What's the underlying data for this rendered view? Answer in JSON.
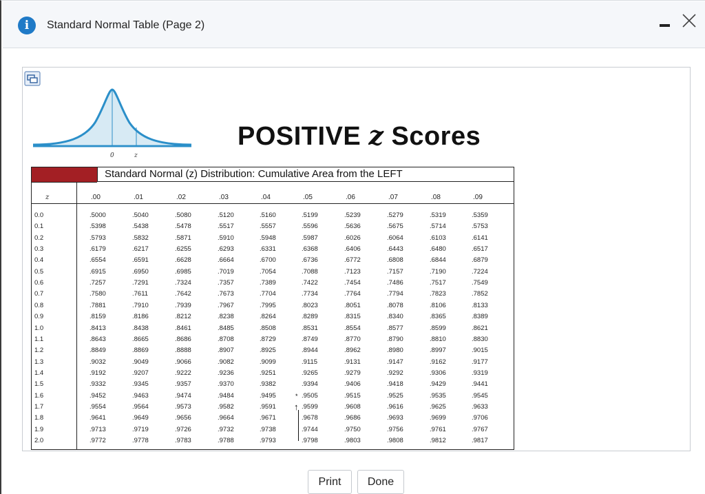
{
  "dialog": {
    "title": "Standard Normal Table (Page 2)",
    "accent": "#1f7ac7"
  },
  "figure": {
    "curve_label_zero": "0",
    "curve_label_z": "z",
    "heading_pre": "POSITIVE ",
    "heading_z": "z",
    "heading_post": " Scores"
  },
  "table": {
    "caption": "Standard Normal (z) Distribution: Cumulative Area from the LEFT",
    "header_color": "#a31f24",
    "z_header": "z",
    "columns": [
      ".00",
      ".01",
      ".02",
      ".03",
      ".04",
      ".05",
      ".06",
      ".07",
      ".08",
      ".09"
    ],
    "rows": [
      {
        "z": "0.0",
        "v": [
          ".5000",
          ".5040",
          ".5080",
          ".5120",
          ".5160",
          ".5199",
          ".5239",
          ".5279",
          ".5319",
          ".5359"
        ]
      },
      {
        "z": "0.1",
        "v": [
          ".5398",
          ".5438",
          ".5478",
          ".5517",
          ".5557",
          ".5596",
          ".5636",
          ".5675",
          ".5714",
          ".5753"
        ]
      },
      {
        "z": "0.2",
        "v": [
          ".5793",
          ".5832",
          ".5871",
          ".5910",
          ".5948",
          ".5987",
          ".6026",
          ".6064",
          ".6103",
          ".6141"
        ]
      },
      {
        "z": "0.3",
        "v": [
          ".6179",
          ".6217",
          ".6255",
          ".6293",
          ".6331",
          ".6368",
          ".6406",
          ".6443",
          ".6480",
          ".6517"
        ]
      },
      {
        "z": "0.4",
        "v": [
          ".6554",
          ".6591",
          ".6628",
          ".6664",
          ".6700",
          ".6736",
          ".6772",
          ".6808",
          ".6844",
          ".6879"
        ]
      },
      {
        "z": "0.5",
        "v": [
          ".6915",
          ".6950",
          ".6985",
          ".7019",
          ".7054",
          ".7088",
          ".7123",
          ".7157",
          ".7190",
          ".7224"
        ]
      },
      {
        "z": "0.6",
        "v": [
          ".7257",
          ".7291",
          ".7324",
          ".7357",
          ".7389",
          ".7422",
          ".7454",
          ".7486",
          ".7517",
          ".7549"
        ]
      },
      {
        "z": "0.7",
        "v": [
          ".7580",
          ".7611",
          ".7642",
          ".7673",
          ".7704",
          ".7734",
          ".7764",
          ".7794",
          ".7823",
          ".7852"
        ]
      },
      {
        "z": "0.8",
        "v": [
          ".7881",
          ".7910",
          ".7939",
          ".7967",
          ".7995",
          ".8023",
          ".8051",
          ".8078",
          ".8106",
          ".8133"
        ]
      },
      {
        "z": "0.9",
        "v": [
          ".8159",
          ".8186",
          ".8212",
          ".8238",
          ".8264",
          ".8289",
          ".8315",
          ".8340",
          ".8365",
          ".8389"
        ]
      },
      {
        "z": "1.0",
        "v": [
          ".8413",
          ".8438",
          ".8461",
          ".8485",
          ".8508",
          ".8531",
          ".8554",
          ".8577",
          ".8599",
          ".8621"
        ]
      },
      {
        "z": "1.1",
        "v": [
          ".8643",
          ".8665",
          ".8686",
          ".8708",
          ".8729",
          ".8749",
          ".8770",
          ".8790",
          ".8810",
          ".8830"
        ]
      },
      {
        "z": "1.2",
        "v": [
          ".8849",
          ".8869",
          ".8888",
          ".8907",
          ".8925",
          ".8944",
          ".8962",
          ".8980",
          ".8997",
          ".9015"
        ]
      },
      {
        "z": "1.3",
        "v": [
          ".9032",
          ".9049",
          ".9066",
          ".9082",
          ".9099",
          ".9115",
          ".9131",
          ".9147",
          ".9162",
          ".9177"
        ]
      },
      {
        "z": "1.4",
        "v": [
          ".9192",
          ".9207",
          ".9222",
          ".9236",
          ".9251",
          ".9265",
          ".9279",
          ".9292",
          ".9306",
          ".9319"
        ]
      },
      {
        "z": "1.5",
        "v": [
          ".9332",
          ".9345",
          ".9357",
          ".9370",
          ".9382",
          ".9394",
          ".9406",
          ".9418",
          ".9429",
          ".9441"
        ]
      },
      {
        "z": "1.6",
        "v": [
          ".9452",
          ".9463",
          ".9474",
          ".9484",
          ".9495",
          ".9505",
          ".9515",
          ".9525",
          ".9535",
          ".9545"
        ]
      },
      {
        "z": "1.7",
        "v": [
          ".9554",
          ".9564",
          ".9573",
          ".9582",
          ".9591",
          ".9599",
          ".9608",
          ".9616",
          ".9625",
          ".9633"
        ]
      },
      {
        "z": "1.8",
        "v": [
          ".9641",
          ".9649",
          ".9656",
          ".9664",
          ".9671",
          ".9678",
          ".9686",
          ".9693",
          ".9699",
          ".9706"
        ]
      },
      {
        "z": "1.9",
        "v": [
          ".9713",
          ".9719",
          ".9726",
          ".9732",
          ".9738",
          ".9744",
          ".9750",
          ".9756",
          ".9761",
          ".9767"
        ]
      },
      {
        "z": "2.0",
        "v": [
          ".9772",
          ".9778",
          ".9783",
          ".9788",
          ".9793",
          ".9798",
          ".9803",
          ".9808",
          ".9812",
          ".9817"
        ]
      }
    ],
    "marker_star": "*",
    "marker_arrow": "↑"
  },
  "buttons": {
    "print": "Print",
    "done": "Done"
  },
  "icons": [
    "info-icon",
    "minimize-icon",
    "close-icon",
    "expand-image-icon"
  ]
}
